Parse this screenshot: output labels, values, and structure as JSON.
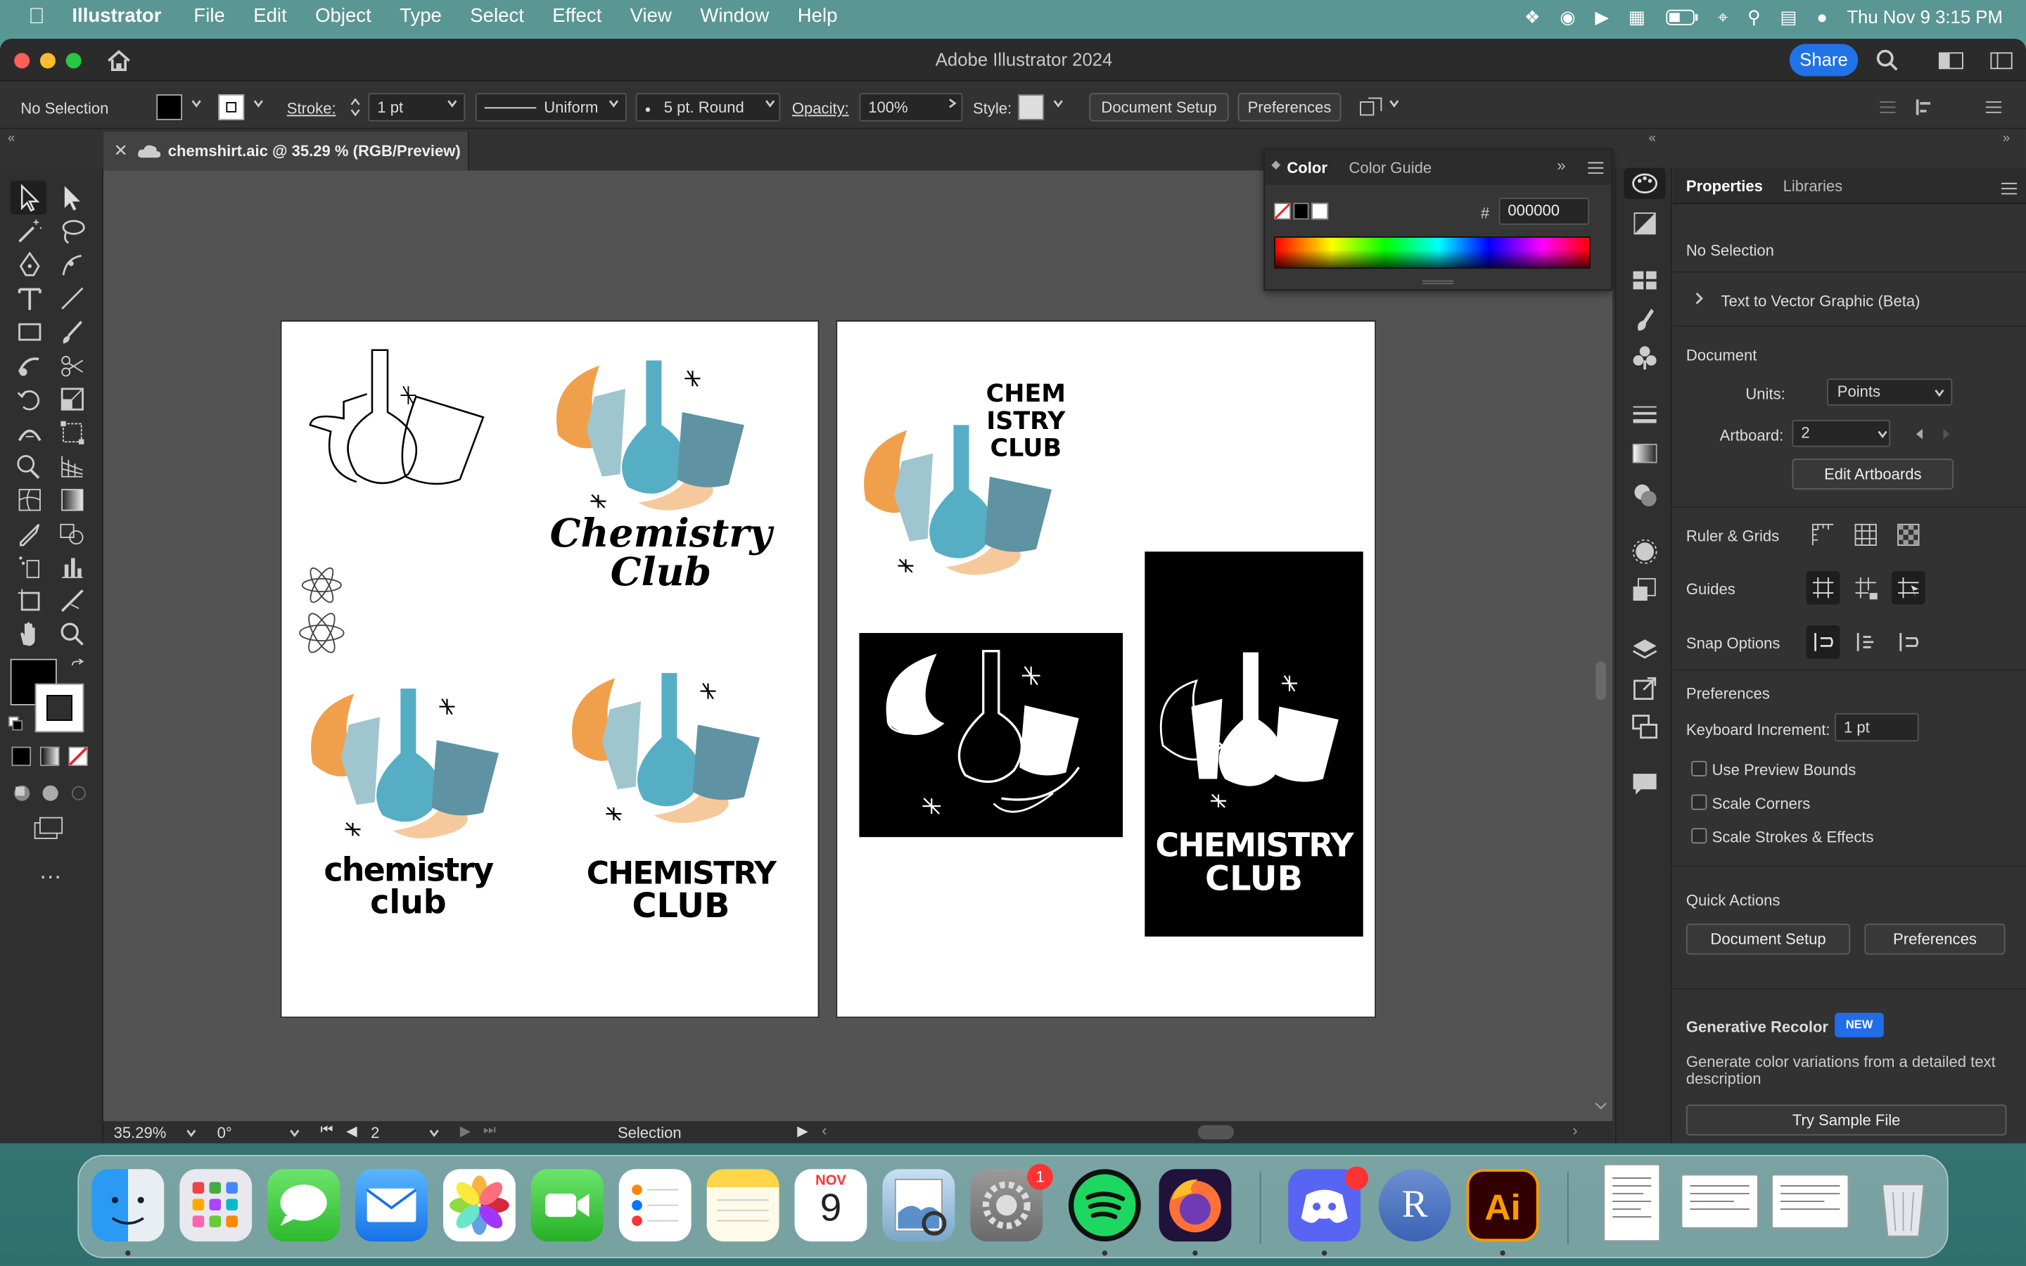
{
  "menubar": {
    "app_name": "Illustrator",
    "items": [
      "File",
      "Edit",
      "Object",
      "Type",
      "Select",
      "Effect",
      "View",
      "Window",
      "Help"
    ],
    "clock": "Thu Nov 9  3:15 PM"
  },
  "window": {
    "title": "Adobe Illustrator 2024",
    "share_label": "Share"
  },
  "control_bar": {
    "selection_state": "No Selection",
    "stroke_label": "Stroke:",
    "stroke_weight": "1 pt",
    "stroke_profile": "Uniform",
    "brush": "5 pt. Round",
    "opacity_label": "Opacity:",
    "opacity_value": "100%",
    "style_label": "Style:",
    "doc_setup_label": "Document Setup",
    "preferences_label": "Preferences"
  },
  "document": {
    "tab_title": "chemshirt.aic @ 35.29 % (RGB/Preview)"
  },
  "artwork": {
    "title_script": [
      "Chemistry",
      "Club"
    ],
    "title_funky": [
      "chemistry",
      "club"
    ],
    "title_caps": [
      "CHEMISTRY",
      "CLUB"
    ],
    "stacked": [
      "CHEM",
      "ISTRY",
      "CLUB"
    ],
    "colors": {
      "orange": "#f0a04b",
      "light_blue": "#9fc6cf",
      "mid_blue": "#56aec5",
      "dark_blue": "#5f93a3",
      "peach": "#f6c99d"
    }
  },
  "status_bar": {
    "zoom": "35.29%",
    "rotation": "0°",
    "artboard_number": "2",
    "tool_name": "Selection"
  },
  "color_panel": {
    "tabs": [
      "Color",
      "Color Guide"
    ],
    "hex_label": "#",
    "hex_value": "000000"
  },
  "properties": {
    "tabs": [
      "Properties",
      "Libraries"
    ],
    "selection_state": "No Selection",
    "text_to_vector": "Text to Vector Graphic (Beta)",
    "document_heading": "Document",
    "units_label": "Units:",
    "units_value": "Points",
    "artboard_label": "Artboard:",
    "artboard_value": "2",
    "edit_artboards": "Edit Artboards",
    "ruler_grids": "Ruler & Grids",
    "guides": "Guides",
    "snap_options": "Snap Options",
    "preferences_heading": "Preferences",
    "keyboard_increment_label": "Keyboard Increment:",
    "keyboard_increment_value": "1 pt",
    "use_preview_bounds": "Use Preview Bounds",
    "scale_corners": "Scale Corners",
    "scale_strokes": "Scale Strokes & Effects",
    "quick_actions": "Quick Actions",
    "document_setup_btn": "Document Setup",
    "preferences_btn": "Preferences",
    "generative_recolor": "Generative Recolor",
    "new_badge": "NEW",
    "gen_desc": "Generate color variations from a detailed text description",
    "try_sample": "Try Sample File"
  },
  "dock": {
    "calendar_month": "NOV",
    "calendar_day": "9",
    "settings_badge": "1",
    "r_label": "R",
    "ai_label": "Ai"
  }
}
